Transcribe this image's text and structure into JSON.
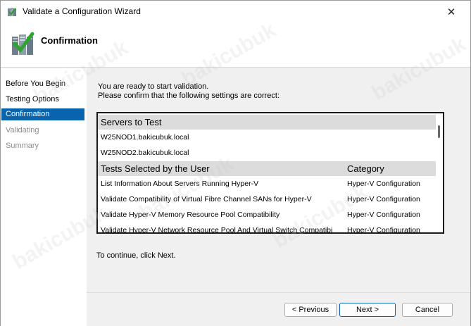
{
  "window": {
    "title": "Validate a Configuration Wizard",
    "close_glyph": "✕"
  },
  "header": {
    "title": "Confirmation",
    "icon": "validate-wizard-icon"
  },
  "sidebar": {
    "items": [
      {
        "label": "Before You Begin",
        "state": "normal"
      },
      {
        "label": "Testing Options",
        "state": "normal"
      },
      {
        "label": "Confirmation",
        "state": "active"
      },
      {
        "label": "Validating",
        "state": "disabled"
      },
      {
        "label": "Summary",
        "state": "disabled"
      }
    ]
  },
  "main": {
    "intro_line1": "You are ready to start validation.",
    "intro_line2": "Please confirm that the following settings are correct:",
    "servers_header": "Servers to Test",
    "servers": [
      "W25NOD1.bakicubuk.local",
      "W25NOD2.bakicubuk.local"
    ],
    "tests_header": "Tests Selected by the User",
    "category_header": "Category",
    "tests": [
      {
        "name": "List Information About Servers Running Hyper-V",
        "category": "Hyper-V Configuration"
      },
      {
        "name": "Validate Compatibility of Virtual Fibre Channel SANs for Hyper-V",
        "category": "Hyper-V Configuration"
      },
      {
        "name": "Validate Hyper-V Memory Resource Pool Compatibility",
        "category": "Hyper-V Configuration"
      },
      {
        "name": "Validate Hyper-V Network Resource Pool And Virtual Switch Compatibi",
        "category": "Hyper-V Configuration"
      }
    ],
    "continue_text": "To continue, click Next."
  },
  "footer": {
    "previous_label": "< Previous",
    "next_label": "Next >",
    "cancel_label": "Cancel"
  },
  "watermark": "bakicubuk",
  "colors": {
    "accent": "#0a64ad",
    "group_header_bg": "#dcdcdc",
    "disabled_text": "#8c8c8c"
  }
}
